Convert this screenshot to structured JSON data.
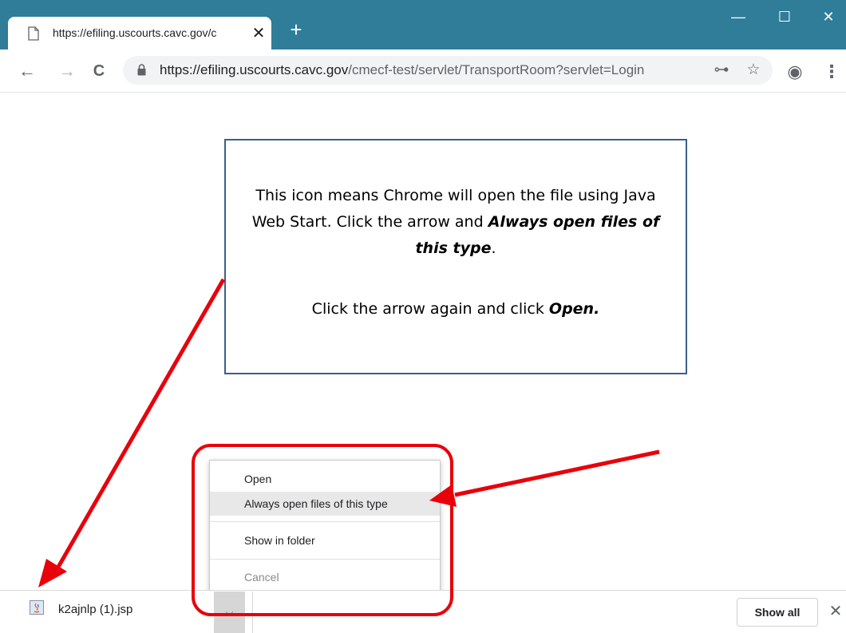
{
  "browser": {
    "tab_title": "https://efiling.uscourts.cavc.gov/c",
    "tab_close": "✕",
    "new_tab": "+",
    "window_controls": {
      "minimize": "—",
      "maximize": "☐",
      "close": "✕"
    },
    "nav": {
      "back": "←",
      "forward": "→",
      "reload": "C"
    },
    "url_host": "https://efiling.uscourts.cavc.gov",
    "url_path": "/cmecf-test/servlet/TransportRoom?servlet=Login",
    "toolbar_icons": [
      "key-icon",
      "star-icon",
      "account-icon",
      "menu-icon"
    ],
    "toolbar_glyphs": {
      "key": "⊶",
      "star": "☆",
      "account": "◉",
      "menu": "⋮"
    }
  },
  "callout": {
    "line1": "This icon means Chrome will open the file using Java Web Start. Click the arrow and",
    "line1_bold": "Always open files of this type",
    "line1_end": ".",
    "line2": "Click the arrow again and click ",
    "line2_bold": "Open."
  },
  "context_menu": {
    "items": [
      {
        "label": "Open",
        "state": "normal"
      },
      {
        "label": "Always open files of this type",
        "state": "highlighted"
      },
      {
        "label": "Show in folder",
        "state": "normal"
      },
      {
        "label": "Cancel",
        "state": "disabled"
      }
    ]
  },
  "download_shelf": {
    "file_name": "k2ajnlp (1).jsp",
    "arrow": "⌵",
    "show_all": "Show all",
    "close": "✕"
  },
  "colors": {
    "titlebar": "#2f7d99",
    "annotation_red": "#e8000b",
    "callout_border": "#3b5f8a"
  }
}
